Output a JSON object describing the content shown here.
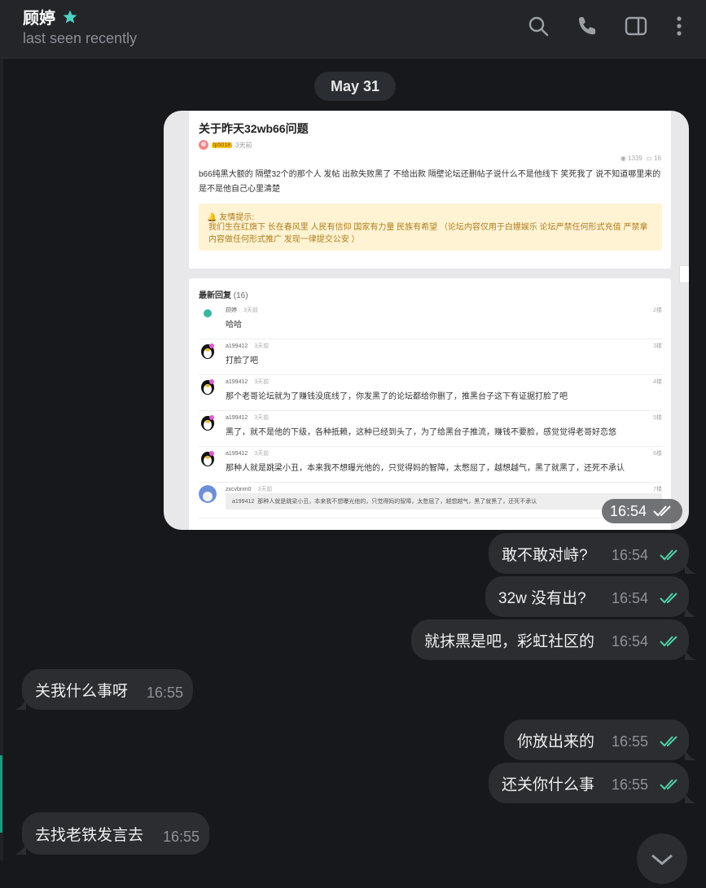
{
  "header": {
    "title": "顾婷",
    "subtitle": "last seen recently",
    "icons": [
      "star-icon",
      "search-icon",
      "phone-icon",
      "sidebar-toggle-icon",
      "more-vertical-icon"
    ],
    "accent_color": "#4fd1c5"
  },
  "date_separator": "May 31",
  "image_message": {
    "time": "16:54",
    "forum": {
      "post_title": "关于昨天32wb66问题",
      "author_badge": "lp5018",
      "posted": "3天前",
      "stats_views": "1339",
      "stats_comments": "16",
      "body": "b66纯黑大额的 隔壁32个的那个人 发帖 出款失败黑了 不给出款 隔壁论坛还删帖子说什么不是他线下 笑死我了 说不知道哪里来的 是不是他自己心里清楚",
      "tip_title": "友情提示:",
      "tip_text": "我们生在红旗下 长在春风里 人民有信仰 国家有力量 民族有希望 （论坛内容仅用于白嫖娱乐 论坛严禁任何形式充值 严禁拿内容做任何形式推广 发现一律提交公安 ）",
      "replies_label": "最新回复",
      "replies_count": "(16)",
      "replies": [
        {
          "user": "顾婷",
          "time": "3天前",
          "floor": "2楼",
          "text": "哈哈"
        },
        {
          "user": "a199412",
          "time": "3天前",
          "floor": "3楼",
          "text": "打脸了吧"
        },
        {
          "user": "a199412",
          "time": "3天前",
          "floor": "4楼",
          "text": "那个老哥论坛就为了赚钱没底线了，你发黑了的论坛都给你删了，推黑台子这下有证据打脸了吧"
        },
        {
          "user": "a199412",
          "time": "3天前",
          "floor": "5楼",
          "text": "黑了，就不是他的下级，各种抵赖，这种已经到头了，为了给黑台子推流，赚钱不要脸，感觉觉得老哥好恋悠"
        },
        {
          "user": "a199412",
          "time": "3天前",
          "floor": "6楼",
          "text": "那种人就是跳梁小丑，本来我不想曝光他的，只觉得妈的智障，太憋屈了，越想越气，黑了就黑了，还死不承认"
        },
        {
          "user": "zxcvbnm0",
          "time": "3天前",
          "floor": "7楼",
          "quote_user": "a199412",
          "quote_text": "那种人就是跳梁小丑，本来我不想曝光他的，只觉得妈的智障，太憋屈了，越想越气，黑了就黑了，还死不承认"
        }
      ]
    }
  },
  "messages": [
    {
      "dir": "out",
      "text": "敢不敢对峙?",
      "time": "16:54"
    },
    {
      "dir": "out",
      "text": "32w 没有出?",
      "time": "16:54"
    },
    {
      "dir": "out",
      "text": "就抹黑是吧，彩虹社区的",
      "time": "16:54"
    },
    {
      "dir": "in",
      "text": "关我什么事呀",
      "time": "16:55"
    },
    {
      "dir": "out",
      "text": "你放出来的",
      "time": "16:55"
    },
    {
      "dir": "out",
      "text": "还关你什么事",
      "time": "16:55"
    },
    {
      "dir": "in",
      "text": "去找老铁发言去",
      "time": "16:55"
    }
  ],
  "colors": {
    "read_check": "#4fd1a5",
    "bubble": "#2b2d31",
    "background": "#16181c"
  }
}
